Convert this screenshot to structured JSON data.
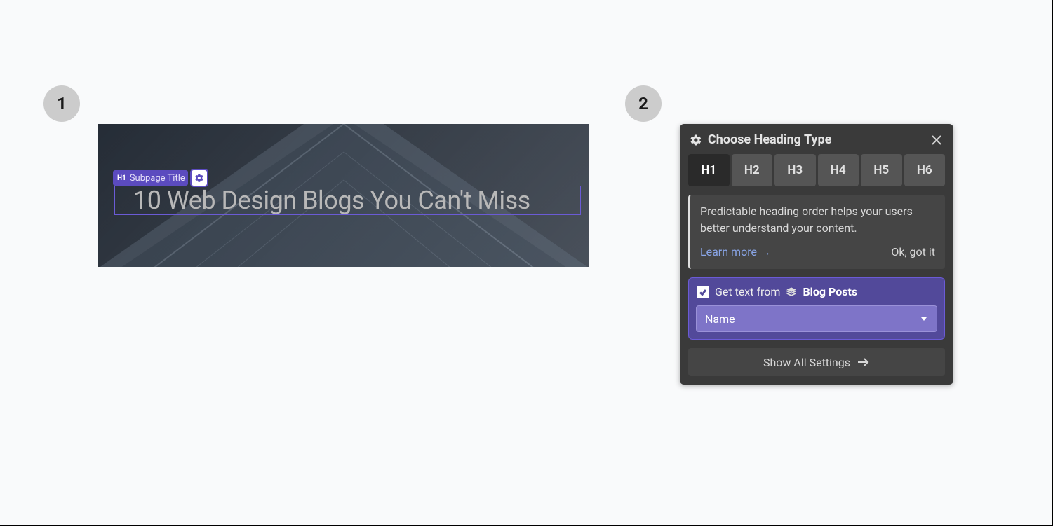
{
  "steps": {
    "one": "1",
    "two": "2"
  },
  "canvas": {
    "tag_type": "H1",
    "tag_label": "Subpage Title",
    "heading_value": "10 Web Design Blogs You Can't Miss"
  },
  "panel": {
    "title": "Choose Heading Type",
    "tabs": [
      "H1",
      "H2",
      "H3",
      "H4",
      "H5",
      "H6"
    ],
    "active_tab": "H1",
    "info_text": "Predictable heading order helps your users better understand your content.",
    "learn_more": "Learn more →",
    "ok": "Ok, got it",
    "bind": {
      "checked": true,
      "prefix": "Get text from",
      "source": "Blog Posts",
      "field": "Name"
    },
    "show_all": "Show All Settings"
  }
}
